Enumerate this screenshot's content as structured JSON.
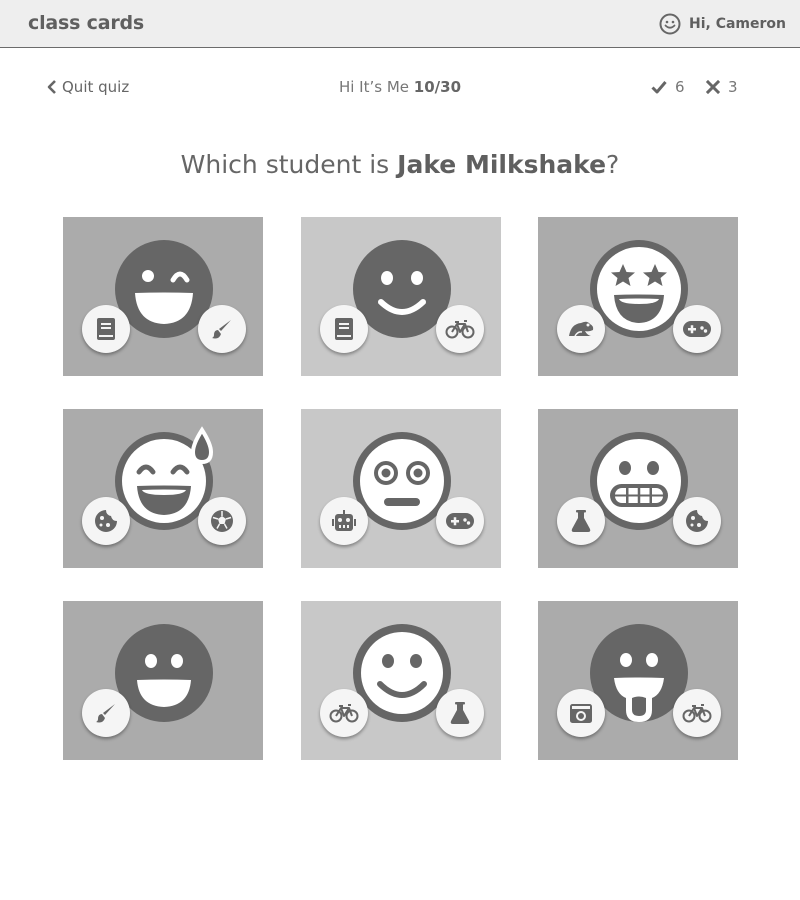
{
  "header": {
    "brand": "class cards",
    "greeting": "Hi, Cameron"
  },
  "quiz": {
    "quit_label": "Quit quiz",
    "name": "Hi It’s Me",
    "progress": "10/30",
    "correct_count": "6",
    "wrong_count": "3"
  },
  "question": {
    "prefix": "Which student is ",
    "name": "Jake Milkshake",
    "suffix": "?"
  },
  "cards": [
    {
      "face": "winking-face-icon",
      "badges": [
        "book-icon",
        "paintbrush-icon"
      ]
    },
    {
      "face": "smiling-face-icon",
      "badges": [
        "book-icon",
        "bicycle-icon"
      ]
    },
    {
      "face": "star-struck-face-icon",
      "badges": [
        "frog-icon",
        "gamepad-icon"
      ]
    },
    {
      "face": "sweat-smile-face-icon",
      "badges": [
        "cookie-icon",
        "soccer-ball-icon"
      ]
    },
    {
      "face": "flushed-face-icon",
      "badges": [
        "robot-icon",
        "gamepad-icon"
      ]
    },
    {
      "face": "grimacing-face-icon",
      "badges": [
        "flask-icon",
        "cookie-icon"
      ]
    },
    {
      "face": "grinning-face-icon",
      "badges": [
        "paintbrush-icon"
      ]
    },
    {
      "face": "outline-smiling-face-icon",
      "badges": [
        "bicycle-icon",
        "flask-icon"
      ]
    },
    {
      "face": "tongue-out-face-icon",
      "badges": [
        "camera-icon",
        "bicycle-icon"
      ]
    }
  ],
  "colors": {
    "header_bg": "#eeeeee",
    "card_dark": "#ababab",
    "card_light": "#c8c8c8",
    "face": "#666666",
    "text": "#666666"
  }
}
